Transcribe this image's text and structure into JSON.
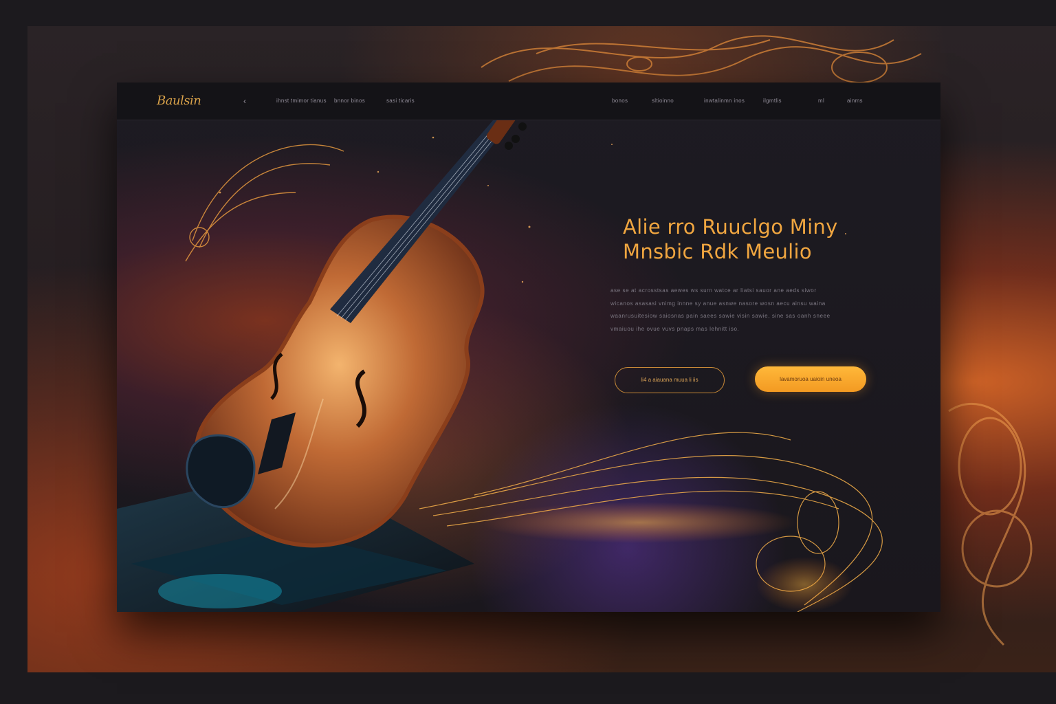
{
  "brand": {
    "logo_text": "Baulsin"
  },
  "nav": {
    "back_glyph": "‹",
    "left_links": [
      "ihnst tmimor tianus",
      "bnnor binos",
      "sasi ticaris"
    ],
    "right_links": [
      "bonos",
      "sltioinno",
      "inwtalinmn inos",
      "ilgmtlis",
      "ml",
      "ainms"
    ]
  },
  "hero": {
    "title_lines": [
      "Alie rro  Ruuclgo Miny",
      "Mnsbic  Rdk Meulio"
    ],
    "body_lines": [
      "ase se at acrosstsas aewes ws surn watce ar liatsi sauor ane aeds siwor",
      "wicanos asasasi vnimg innne sy anue asnwe nasore wosn aecu ainsu waina",
      "waanrusuitesiow saiosnas pain saees sawie visin sawie, sine sas oanh sneee",
      "vmaiuou ihe ovue vuvs pnaps mas lehnitt iso."
    ],
    "secondary_button": "li4  a aiauana  muua  li  iis",
    "primary_button": "lavamoruoa  uaioin uneoa"
  },
  "colors": {
    "accent": "#f0a640",
    "button_primary": "#f8a92c",
    "background": "#1a171d"
  },
  "icons": [
    "back-chevron-icon",
    "violin-illustration",
    "music-swirl-decoration"
  ]
}
